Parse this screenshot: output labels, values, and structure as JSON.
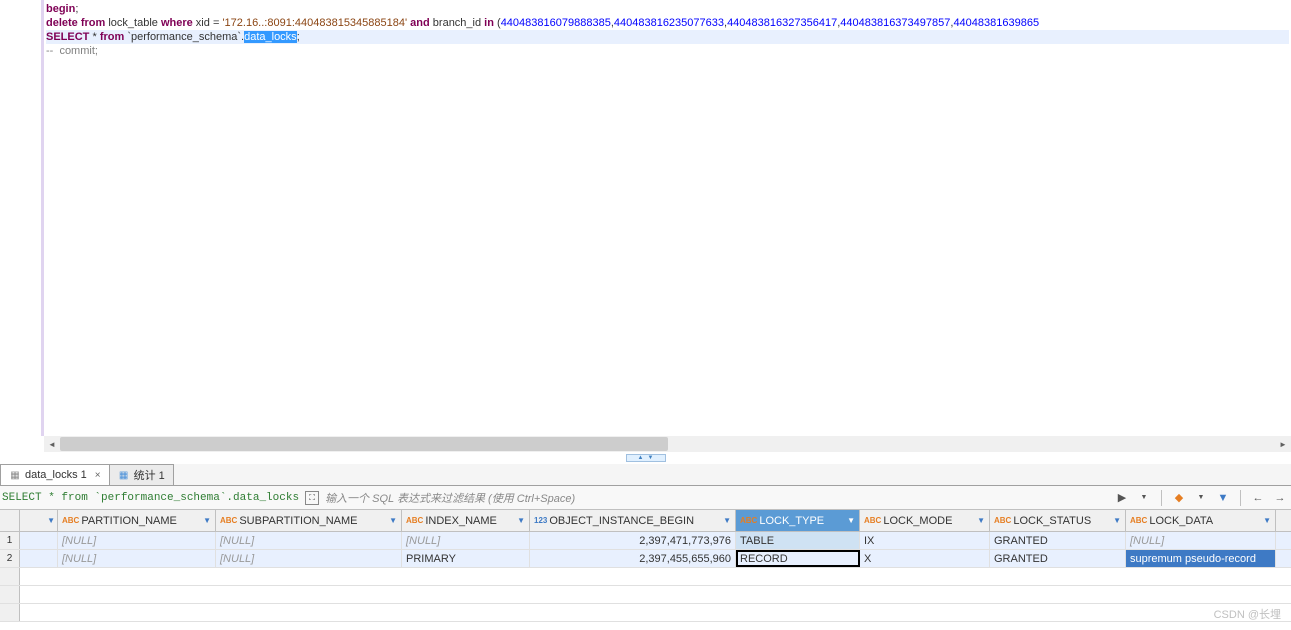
{
  "editor": {
    "lines": [
      {
        "raw": "begin;",
        "tokens": [
          {
            "t": "begin",
            "c": "kw-red"
          },
          {
            "t": ";",
            "c": ""
          }
        ]
      },
      {
        "raw": "delete from lock_table where xid = '172.16..:8091:440483815345885184' and branch_id in (440483816079888385,440483816235077633,440483816327356417,440483816373497857,44048381639865",
        "tokens": [
          {
            "t": "delete from",
            "c": "kw-red"
          },
          {
            "t": " lock_table ",
            "c": ""
          },
          {
            "t": "where",
            "c": "kw-red"
          },
          {
            "t": " xid ",
            "c": ""
          },
          {
            "t": "=",
            "c": ""
          },
          {
            "t": " ",
            "c": ""
          },
          {
            "t": "'172.16..:8091:440483815345885184'",
            "c": "str-brown"
          },
          {
            "t": " ",
            "c": ""
          },
          {
            "t": "and",
            "c": "kw-red"
          },
          {
            "t": " branch_id ",
            "c": ""
          },
          {
            "t": "in",
            "c": "kw-red"
          },
          {
            "t": " (",
            "c": ""
          },
          {
            "t": "440483816079888385",
            "c": "kw-blue"
          },
          {
            "t": ",",
            "c": ""
          },
          {
            "t": "440483816235077633",
            "c": "kw-blue"
          },
          {
            "t": ",",
            "c": ""
          },
          {
            "t": "440483816327356417",
            "c": "kw-blue"
          },
          {
            "t": ",",
            "c": ""
          },
          {
            "t": "440483816373497857",
            "c": "kw-blue"
          },
          {
            "t": ",",
            "c": ""
          },
          {
            "t": "44048381639865",
            "c": "kw-blue"
          }
        ]
      },
      {
        "highlight": true,
        "tokens": [
          {
            "t": "SELECT",
            "c": "kw-red"
          },
          {
            "t": " * ",
            "c": ""
          },
          {
            "t": "from",
            "c": "kw-red"
          },
          {
            "t": " `performance_schema`.",
            "c": ""
          },
          {
            "t": "data_locks",
            "c": "selected-text"
          },
          {
            "t": ";",
            "c": ""
          }
        ]
      },
      {
        "tokens": [
          {
            "t": "--  commit;",
            "c": "comment"
          }
        ]
      }
    ]
  },
  "tabs": [
    {
      "label": "data_locks 1",
      "active": true,
      "icon_color": "#888",
      "closable": true
    },
    {
      "label": "统计 1",
      "active": false,
      "icon_color": "#4a90d9",
      "closable": false
    }
  ],
  "filter": {
    "query": "SELECT * from `performance_schema`.data_locks",
    "placeholder": "输入一个 SQL 表达式来过滤结果 (使用 Ctrl+Space)"
  },
  "columns": [
    {
      "name": "PARTITION_NAME",
      "type": "ABC",
      "width": "c-partition",
      "selected": false
    },
    {
      "name": "SUBPARTITION_NAME",
      "type": "ABC",
      "width": "c-subpartition",
      "selected": false
    },
    {
      "name": "INDEX_NAME",
      "type": "ABC",
      "width": "c-index",
      "selected": false
    },
    {
      "name": "OBJECT_INSTANCE_BEGIN",
      "type": "123",
      "width": "c-objinst",
      "selected": false
    },
    {
      "name": "LOCK_TYPE",
      "type": "ABC",
      "width": "c-locktype",
      "selected": true
    },
    {
      "name": "LOCK_MODE",
      "type": "ABC",
      "width": "c-lockmode",
      "selected": false
    },
    {
      "name": "LOCK_STATUS",
      "type": "ABC",
      "width": "c-lockstatus",
      "selected": false
    },
    {
      "name": "LOCK_DATA",
      "type": "ABC",
      "width": "c-lockdata",
      "selected": false
    }
  ],
  "rows": [
    {
      "n": "1",
      "cells": [
        {
          "v": "[NULL]",
          "null": true
        },
        {
          "v": "[NULL]",
          "null": true
        },
        {
          "v": "[NULL]",
          "null": true
        },
        {
          "v": "2,397,471,773,976",
          "num": true
        },
        {
          "v": "TABLE",
          "selcol": true
        },
        {
          "v": "IX"
        },
        {
          "v": "GRANTED"
        },
        {
          "v": "[NULL]",
          "null": true
        }
      ]
    },
    {
      "n": "2",
      "cells": [
        {
          "v": "[NULL]",
          "null": true
        },
        {
          "v": "[NULL]",
          "null": true
        },
        {
          "v": "PRIMARY"
        },
        {
          "v": "2,397,455,655,960",
          "num": true
        },
        {
          "v": "RECORD",
          "selcol": true,
          "focused": true
        },
        {
          "v": "X"
        },
        {
          "v": "GRANTED"
        },
        {
          "v": "supremum pseudo-record",
          "bluesel": true
        }
      ]
    }
  ],
  "watermark": "CSDN @长埋"
}
